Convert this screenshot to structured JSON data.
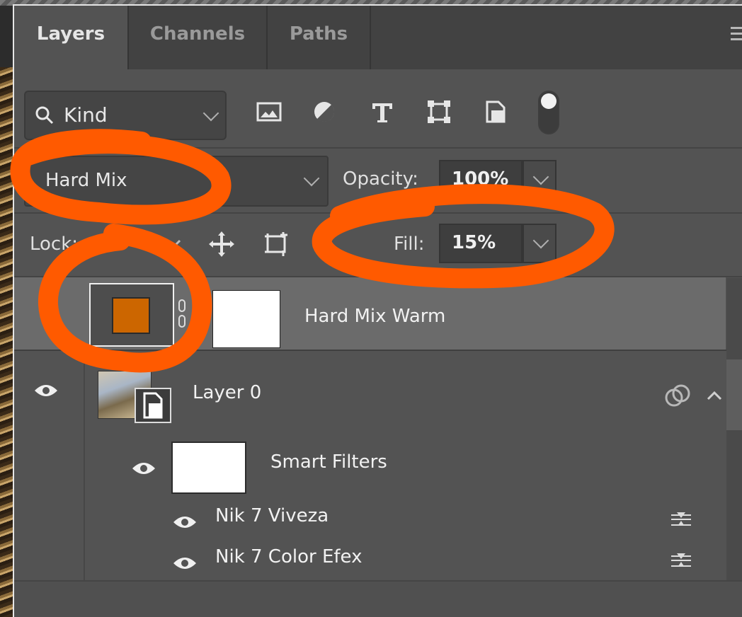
{
  "panel": {
    "tabs": [
      {
        "label": "Layers",
        "active": true
      },
      {
        "label": "Channels",
        "active": false
      },
      {
        "label": "Paths",
        "active": false
      }
    ]
  },
  "filter": {
    "kind_label": "Kind",
    "icons": [
      "pixel-layer-filter-icon",
      "adjustment-layer-filter-icon",
      "type-layer-filter-icon",
      "shape-layer-filter-icon",
      "smart-object-filter-icon",
      "filter-toggle-icon"
    ]
  },
  "blend": {
    "mode": "Hard Mix",
    "opacity_label": "Opacity:",
    "opacity_value": "100%",
    "fill_label": "Fill:",
    "fill_value": "15%"
  },
  "lock": {
    "label": "Lock:"
  },
  "layers": [
    {
      "name": "Hard Mix Warm",
      "selected": true,
      "swatch_color": "#cc6600"
    },
    {
      "name": "Layer 0",
      "selected": false
    }
  ],
  "smart_filters": {
    "label": "Smart Filters",
    "items": [
      {
        "name": "Nik 7 Viveza"
      },
      {
        "name": "Nik 7 Color Efex"
      }
    ]
  },
  "annotation_color": "#ff5a00"
}
